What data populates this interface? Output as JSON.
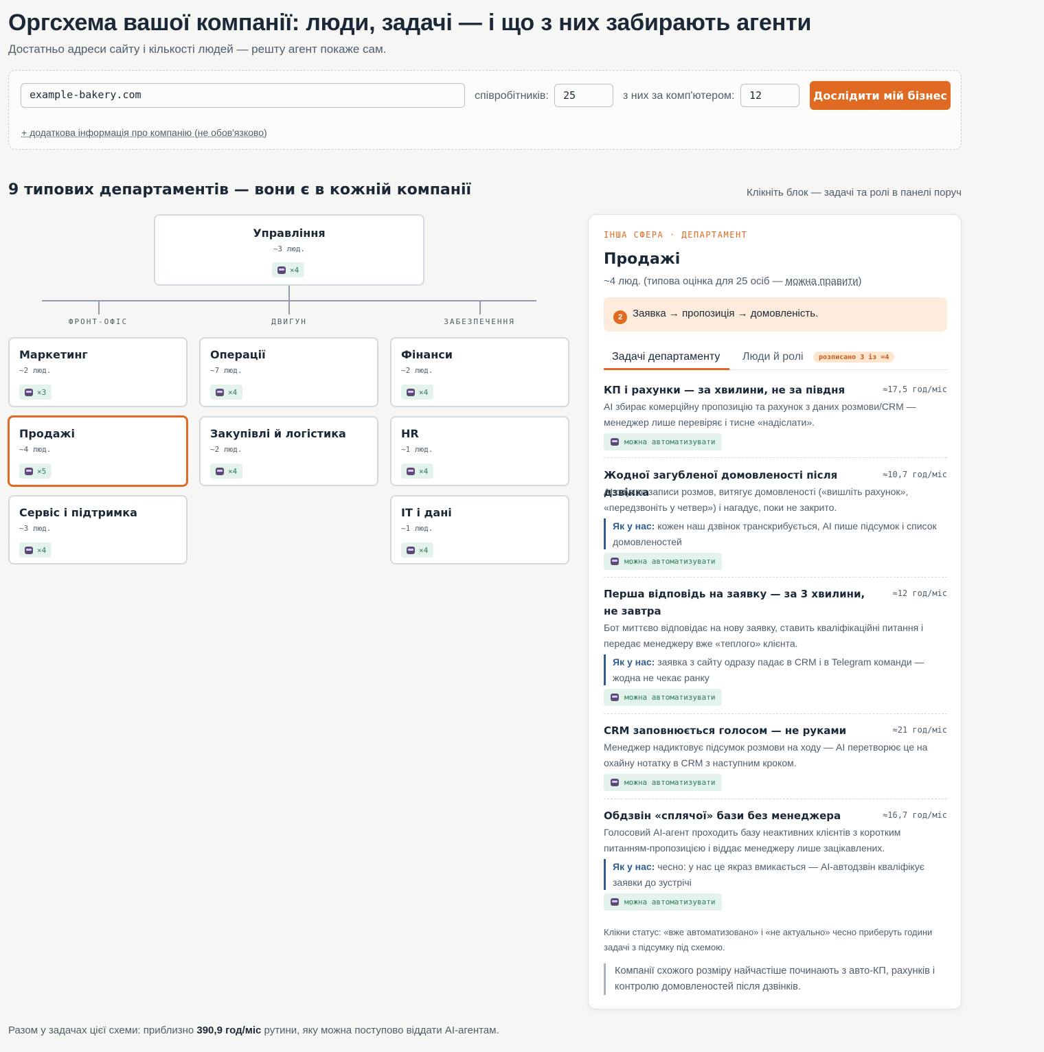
{
  "header": {
    "title": "Оргсхема вашої компанії: люди, задачі — і що з них забирають агенти",
    "subtitle": "Достатньо адреси сайту і кількості людей — решту агент покаже сам."
  },
  "form": {
    "site_value": "example-bakery.com",
    "employees_label": "співробітників:",
    "employees_value": "25",
    "computer_label": "з них за комп'ютером:",
    "computer_value": "12",
    "submit_label": "Дослідити мій бізнес",
    "extra_link": "+ додаткова інформація про компанію (не обов'язково)"
  },
  "section": {
    "title": "9 типових департаментів — вони є в кожній компанії",
    "hint": "Клікніть блок — задачі та ролі в панелі поруч"
  },
  "groups": {
    "front": "ФРОНТ-ОФІС",
    "engine": "ДВИГУН",
    "support": "ЗАБЕЗПЕЧЕННЯ"
  },
  "departments": {
    "management": {
      "name": "Управління",
      "people": "~3 люд.",
      "agents": "×4"
    },
    "marketing": {
      "name": "Маркетинг",
      "people": "~2 люд.",
      "agents": "×3"
    },
    "sales": {
      "name": "Продажі",
      "people": "~4 люд.",
      "agents": "×5"
    },
    "service": {
      "name": "Сервіс і підтримка",
      "people": "~3 люд.",
      "agents": "×4"
    },
    "operations": {
      "name": "Операції",
      "people": "~7 люд.",
      "agents": "×4"
    },
    "procurement": {
      "name": "Закупівлі й логістика",
      "people": "~2 люд.",
      "agents": "×4"
    },
    "finance": {
      "name": "Фінанси",
      "people": "~2 люд.",
      "agents": "×4"
    },
    "hr": {
      "name": "HR",
      "people": "~1 люд.",
      "agents": "×4"
    },
    "it": {
      "name": "IT і дані",
      "people": "~1 люд.",
      "agents": "×4"
    }
  },
  "panel": {
    "kicker": "ІНША СФЕРА · ДЕПАРТАМЕНТ",
    "title": "Продажі",
    "people_prefix": "~4 люд. (типова оцінка для 25 осіб — ",
    "people_edit": "можна правити",
    "people_suffix": ")",
    "callout_num": "2",
    "callout_text": "Заявка → пропозиція → домовленість.",
    "tab_tasks": "Задачі департаменту",
    "tab_people": "Люди й ролі",
    "tab_people_badge": "розписано 3 із ≈4",
    "note_label": "Як у нас:",
    "tasks": [
      {
        "title": "КП і рахунки — за хвилини, не за півдня",
        "hours": "≈17,5 год/міс",
        "desc": "AI збирає комерційну пропозицію та рахунок з даних розмови/CRM — менеджер лише перевіряє і тисне «надіслати».",
        "note": "",
        "status": "можна автоматизувати"
      },
      {
        "title": "Жодної загубленої домовленості після дзвінка",
        "hours": "≈10,7 год/міс",
        "desc": "AI слухає записи розмов, витягує домовленості («вишліть рахунок», «передзвоніть у четвер») і нагадує, поки не закрито.",
        "note": "кожен наш дзвінок транскрибується, AI пише підсумок і список домовленостей",
        "status": "можна автоматизувати"
      },
      {
        "title": "Перша відповідь на заявку — за 3 хвилини, не завтра",
        "hours": "≈12 год/міс",
        "desc": "Бот миттєво відповідає на нову заявку, ставить кваліфікаційні питання і передає менеджеру вже «теплого» клієнта.",
        "note": "заявка з сайту одразу падає в CRM і в Telegram команди — жодна не чекає ранку",
        "status": "можна автоматизувати"
      },
      {
        "title": "CRM заповнюється голосом — не руками",
        "hours": "≈21 год/міс",
        "desc": "Менеджер надиктовує підсумок розмови на ходу — AI перетворює це на охайну нотатку в CRM з наступним кроком.",
        "note": "",
        "status": "можна автоматизувати"
      },
      {
        "title": "Обдзвін «сплячої» бази без менеджера",
        "hours": "≈16,7 год/міс",
        "desc": "Голосовий AI-агент проходить базу неактивних клієнтів з коротким питанням-пропозицією і віддає менеджеру лише зацікавлених.",
        "note": "чесно: у нас це якраз вмикається — AI-автодзвін кваліфікує заявки до зустрічі",
        "status": "можна автоматизувати"
      }
    ],
    "footnote": "Клікни статус: «вже автоматизовано» і «не актуально» чесно приберуть години задачі з підсумку під схемою.",
    "quote": "Компанії схожого розміру найчастіше починають з авто-КП, рахунків і контролю домовленостей після дзвінків."
  },
  "summary": {
    "prefix": "Разом у задачах цієї схеми: приблизно ",
    "value": "390,9 год/міс",
    "suffix": " рутини, яку можна поступово віддати AI-агентам."
  }
}
